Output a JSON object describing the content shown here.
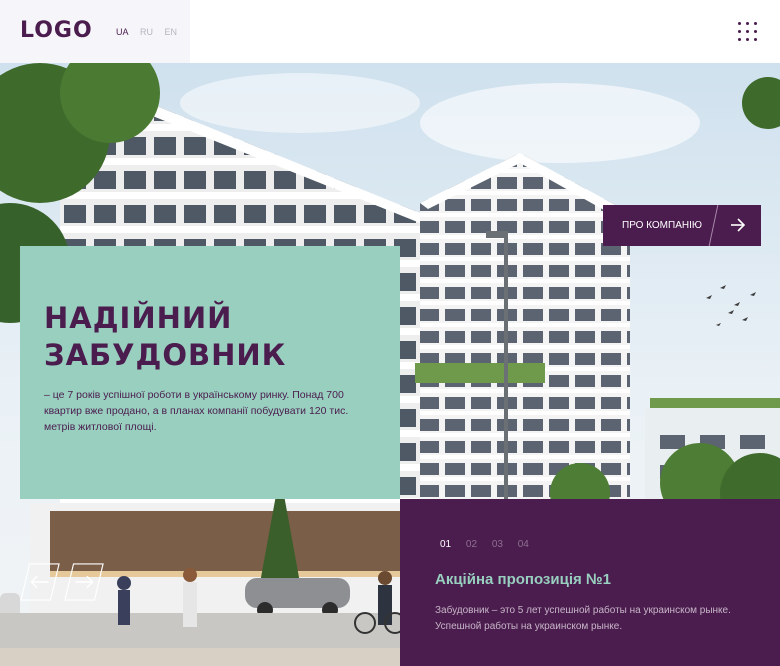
{
  "header": {
    "logo": "LOGO",
    "languages": [
      {
        "code": "UA",
        "active": true
      },
      {
        "code": "RU",
        "active": false
      },
      {
        "code": "EN",
        "active": false
      }
    ],
    "menu_icon": "grid-menu-icon"
  },
  "hero": {
    "title": "НАДІЙНИЙ ЗАБУДОВНИК",
    "description": "– це 7 років успішної роботи в українському ринку. Понад 700 квартир вже продано, а в планах компанії побудувати 120 тис. метрів житлової площі.",
    "about_button_label": "ПРО КОМПАНІЮ",
    "about_button_icon": "arrow-right-icon"
  },
  "slider": {
    "prev_icon": "arrow-left-icon",
    "next_icon": "arrow-right-icon"
  },
  "promo": {
    "tabs": [
      "01",
      "02",
      "03",
      "04"
    ],
    "active_tab": 0,
    "title": "Акційна пропозиція №1",
    "text": "Забудовник – это 5 лет успешной работы на украинском рынке. Успешной работы на украинском рынке."
  },
  "colors": {
    "brand_purple": "#4b1c4e",
    "mint": "#98cfbf",
    "header_left_bg": "#f6f6fa"
  }
}
